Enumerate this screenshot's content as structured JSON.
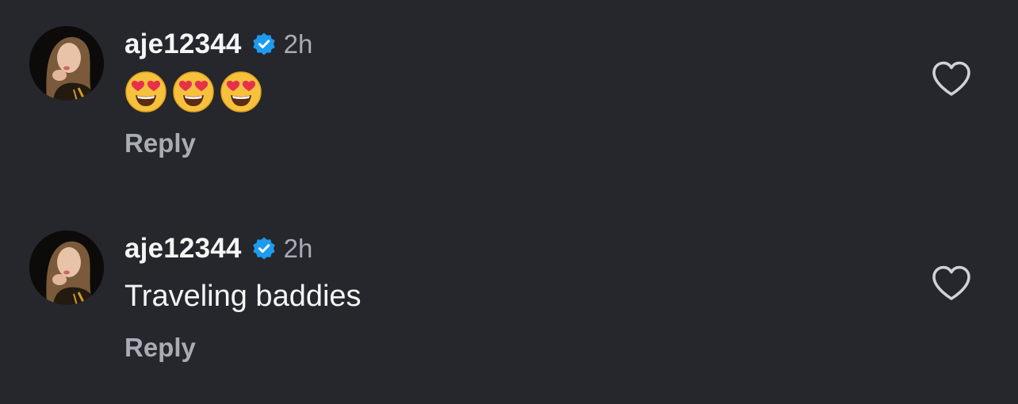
{
  "comments": [
    {
      "username": "aje12344",
      "time": "2h",
      "text": "",
      "emojis": [
        "smiling-face-with-heart-eyes",
        "smiling-face-with-heart-eyes",
        "smiling-face-with-heart-eyes"
      ],
      "reply_label": "Reply"
    },
    {
      "username": "aje12344",
      "time": "2h",
      "text": "Traveling baddies",
      "emojis": [],
      "reply_label": "Reply"
    }
  ],
  "colors": {
    "background": "#25272c",
    "username": "#f5f5f5",
    "secondary": "#a8acb3",
    "verified": "#1d9bf0",
    "heart_outline": "#cfd2d7"
  },
  "icons": {
    "verified": "verified-badge-icon",
    "like": "heart-outline-icon",
    "emoji": "smiling-face-with-heart-eyes"
  }
}
